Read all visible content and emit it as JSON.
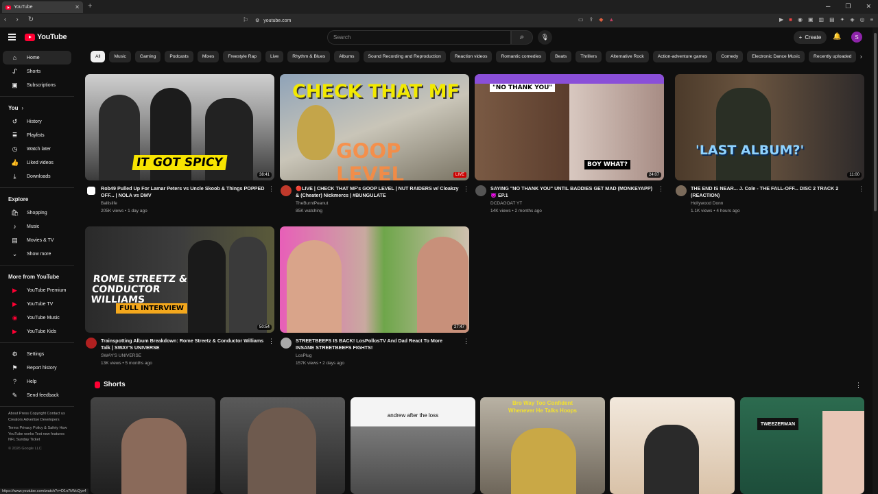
{
  "browser": {
    "tab_title": "YouTube",
    "url": "youtube.com",
    "status_url": "https://www.youtube.com/watch?v=D1n7kWcQyx4"
  },
  "header": {
    "logo": "YouTube",
    "search_placeholder": "Search",
    "create": "Create",
    "avatar_letter": "S"
  },
  "sidebar": {
    "main": [
      {
        "label": "Home",
        "icon": "home-icon"
      },
      {
        "label": "Shorts",
        "icon": "shorts-icon"
      },
      {
        "label": "Subscriptions",
        "icon": "subscriptions-icon"
      }
    ],
    "you_title": "You",
    "you": [
      {
        "label": "History"
      },
      {
        "label": "Playlists"
      },
      {
        "label": "Watch later"
      },
      {
        "label": "Liked videos"
      },
      {
        "label": "Downloads"
      }
    ],
    "explore_title": "Explore",
    "explore": [
      {
        "label": "Shopping"
      },
      {
        "label": "Music"
      },
      {
        "label": "Movies & TV"
      },
      {
        "label": "Show more"
      }
    ],
    "more_title": "More from YouTube",
    "more": [
      {
        "label": "YouTube Premium"
      },
      {
        "label": "YouTube TV"
      },
      {
        "label": "YouTube Music"
      },
      {
        "label": "YouTube Kids"
      }
    ],
    "settings": [
      {
        "label": "Settings"
      },
      {
        "label": "Report history"
      },
      {
        "label": "Help"
      },
      {
        "label": "Send feedback"
      }
    ],
    "footer1": "About  Press  Copyright  Contact us  Creators  Advertise  Developers",
    "footer2": "Terms  Privacy  Policy & Safety  How YouTube works  Test new features  NFL Sunday Ticket",
    "copyright": "© 2026 Google LLC"
  },
  "chips": [
    "All",
    "Music",
    "Gaming",
    "Podcasts",
    "Mixes",
    "Freestyle Rap",
    "Live",
    "Rhythm & Blues",
    "Albums",
    "Sound Recording and Reproduction",
    "Reaction videos",
    "Romantic comedies",
    "Beats",
    "Thrillers",
    "Alternative Rock",
    "Action-adventure games",
    "Comedy",
    "Electronic Dance Music",
    "Recently uploaded"
  ],
  "videos": [
    {
      "title": "Rob49 Pulled Up For Lamar Peters vs Uncle Skoob & Things POPPED OFF... | NOLA vs DMV",
      "channel": "Ballislife",
      "meta": "205K views • 1 day ago",
      "duration": "38:41",
      "overlay": "IT GOT SPICY"
    },
    {
      "title": "🔴LIVE | CHECK THAT MF's GOOP LEVEL | NUT RAIDERS w/ Cloakzy & (Cheater) Nickmercs | #BUNGULATE",
      "channel": "TheBurntPeanut",
      "meta": "85K watching",
      "duration": "LIVE",
      "overlay": "CHECK THAT MF",
      "overlay2": "GOOP LEVEL"
    },
    {
      "title": "SAYING \"NO THANK YOU\" UNTIL BADDIES GET MAD (MONKEYAPP) 😈 EP.1",
      "channel": "DCDAGOAT YT",
      "meta": "14K views • 2 months ago",
      "duration": "24:07",
      "overlay": "\"NO THANK YOU\"",
      "overlay2": "BOY WHAT?"
    },
    {
      "title": "THE END IS NEAR... J. Cole - THE FALL-OFF... DISC 2 TRACK 2 (REACTION)",
      "channel": "Hollywood Donn",
      "meta": "1.1K views • 4 hours ago",
      "duration": "11:00",
      "overlay": "'LAST ALBUM?'"
    },
    {
      "title": "Trainspotting Album Breakdown: Rome Streetz & Conductor Williams Talk | SWAY'S UNIVERSE",
      "channel": "SWAY'S UNIVERSE",
      "meta": "13K views • 5 months ago",
      "duration": "50:54",
      "overlay": "ROME STREETZ & CONDUCTOR WILLIAMS",
      "overlay2": "FULL INTERVIEW"
    },
    {
      "title": "STREETBEEFS IS BACK! LosPollosTV And Dad React To More INSANE STREETBEEFS FIGHTS!",
      "channel": "LosPlug",
      "meta": "157K views • 2 days ago",
      "duration": "27:47"
    }
  ],
  "shorts": {
    "title": "Shorts",
    "captions": [
      "",
      "",
      "andrew after the loss",
      "Bro Way Too Confident Whenever He Talks Hoops",
      "",
      "TWEEZERMAN"
    ]
  }
}
